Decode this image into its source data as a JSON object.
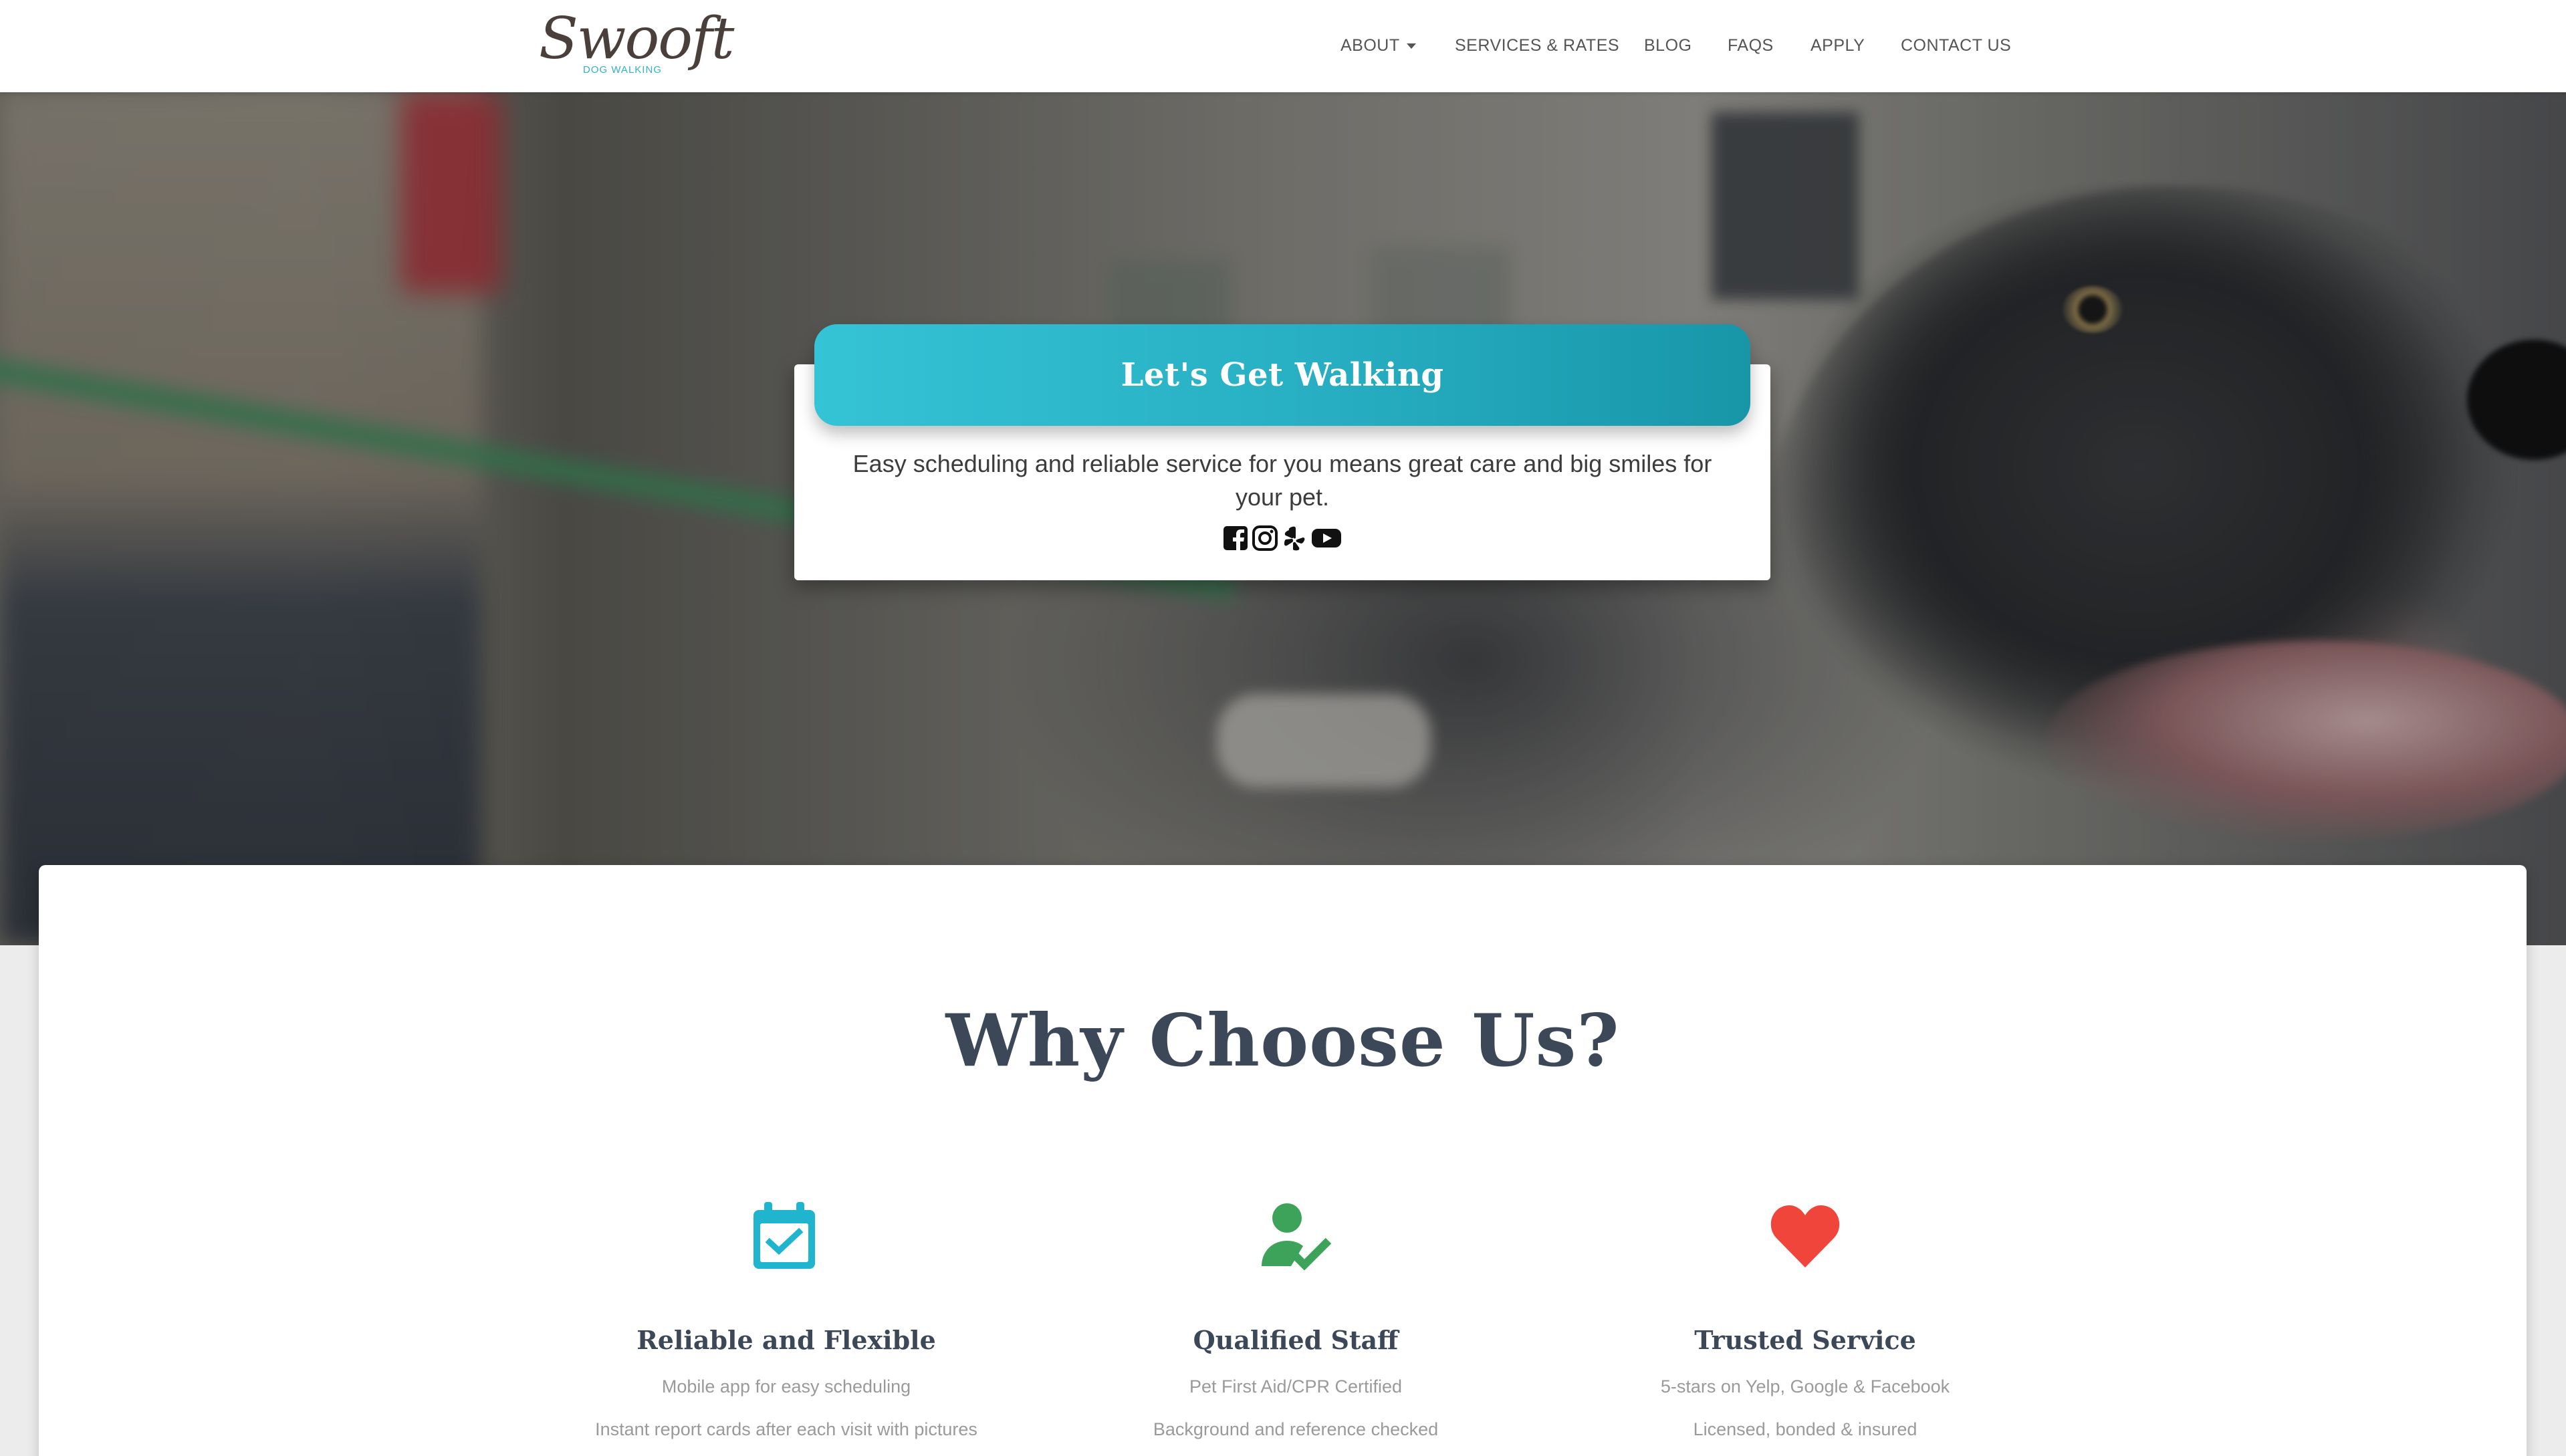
{
  "brand": {
    "name": "Swooft",
    "tagline": "DOG WALKING"
  },
  "nav": {
    "items": [
      {
        "label": "ABOUT",
        "has_dropdown": true
      },
      {
        "label": "SERVICES & RATES"
      },
      {
        "label": "BLOG"
      },
      {
        "label": "FAQS"
      },
      {
        "label": "APPLY"
      },
      {
        "label": "CONTACT US"
      }
    ]
  },
  "hero": {
    "title": "Let's Get Walking",
    "text": "Easy scheduling and reliable service for you means great care and big smiles for your pet.",
    "social": [
      {
        "icon": "facebook-icon"
      },
      {
        "icon": "instagram-icon"
      },
      {
        "icon": "yelp-icon"
      },
      {
        "icon": "youtube-icon"
      }
    ]
  },
  "why": {
    "title": "Why Choose Us?",
    "features": [
      {
        "icon": "calendar-check-icon",
        "title": "Reliable and Flexible",
        "lines": [
          "Mobile app for easy scheduling",
          "Instant report cards after each visit with pictures"
        ]
      },
      {
        "icon": "person-check-icon",
        "title": "Qualified Staff",
        "lines": [
          "Pet First Aid/CPR Certified",
          "Background and reference checked"
        ]
      },
      {
        "icon": "heart-icon",
        "title": "Trusted Service",
        "lines": [
          "5-stars on Yelp, Google & Facebook",
          "Licensed, bonded & insured"
        ]
      }
    ]
  },
  "colors": {
    "accent": "#2fb3c9",
    "calendar": "#1fb5cf",
    "staff": "#3ea35a",
    "heart": "#f0453a",
    "heading": "#3c4858"
  }
}
